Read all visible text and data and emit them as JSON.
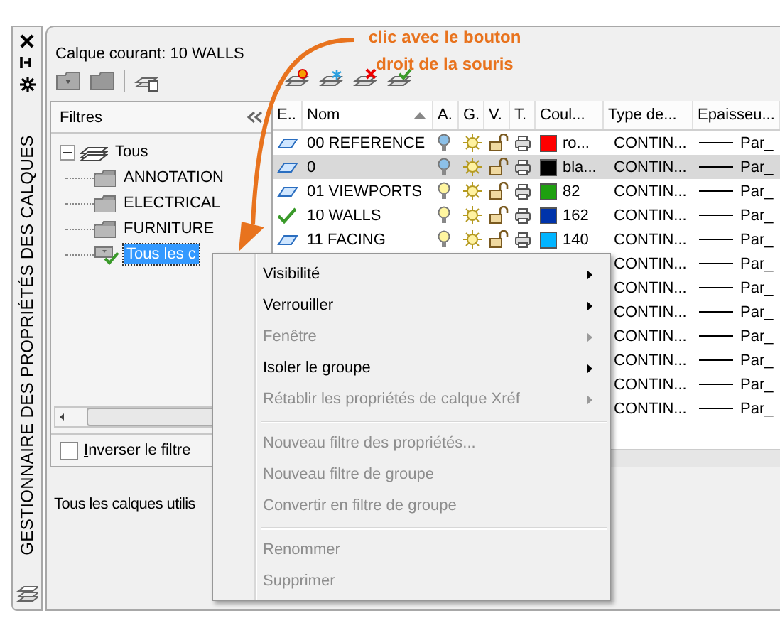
{
  "side_strip": {
    "title": "GESTIONNAIRE DES PROPRIÉTÉS DES CALQUES"
  },
  "annotation": {
    "text": "clic avec le bouton droit de la souris"
  },
  "current_layer": "Calque courant: 10 WALLS",
  "filters": {
    "title": "Filtres",
    "tree": [
      {
        "label": "Tous",
        "kind": "all",
        "expanded": true,
        "selected": false,
        "children": [
          {
            "label": "ANNOTATION",
            "kind": "group",
            "selected": false
          },
          {
            "label": "ELECTRICAL",
            "kind": "group",
            "selected": false
          },
          {
            "label": "FURNITURE",
            "kind": "group",
            "selected": false
          },
          {
            "label": "Tous les c",
            "kind": "used",
            "selected": true
          }
        ]
      }
    ],
    "invert": {
      "label": "Inverser le filtre",
      "checked": false
    }
  },
  "table": {
    "columns": [
      {
        "label": "E..",
        "sorted": false
      },
      {
        "label": "Nom",
        "sorted": true
      },
      {
        "label": "A.",
        "sorted": false
      },
      {
        "label": "G.",
        "sorted": false
      },
      {
        "label": "V.",
        "sorted": false
      },
      {
        "label": "T.",
        "sorted": false
      },
      {
        "label": "Coul...",
        "sorted": false
      },
      {
        "label": "Type de...",
        "sorted": false
      },
      {
        "label": "Epaisseu...",
        "sorted": false
      }
    ],
    "rows": [
      {
        "kind": "layer",
        "name": "00 REFERENCE",
        "on": false,
        "color": "#ff0000",
        "color_name": "ro...",
        "linetype": "CONTIN...",
        "lineweight": "Par_",
        "selected": false
      },
      {
        "kind": "layer",
        "name": "0",
        "on": false,
        "color": "#000000",
        "color_name": "bla...",
        "linetype": "CONTIN...",
        "lineweight": "Par_",
        "selected": true
      },
      {
        "kind": "layer",
        "name": "01 VIEWPORTS",
        "on": true,
        "color": "#1ea010",
        "color_name": "82",
        "linetype": "CONTIN...",
        "lineweight": "Par_",
        "selected": false
      },
      {
        "kind": "current",
        "name": "10 WALLS",
        "on": true,
        "color": "#0033aa",
        "color_name": "162",
        "linetype": "CONTIN...",
        "lineweight": "Par_",
        "selected": false
      },
      {
        "kind": "layer",
        "name": "11 FACING",
        "on": true,
        "color": "#00b4ff",
        "color_name": "140",
        "linetype": "CONTIN...",
        "lineweight": "Par_",
        "selected": false
      },
      {
        "linetype": "CONTIN...",
        "lineweight": "Par_",
        "selected": false
      },
      {
        "linetype": "CONTIN...",
        "lineweight": "Par_",
        "selected": false
      },
      {
        "linetype": "CONTIN...",
        "lineweight": "Par_",
        "selected": false
      },
      {
        "linetype": "CONTIN...",
        "lineweight": "Par_",
        "selected": false
      },
      {
        "linetype": "CONTIN...",
        "lineweight": "Par_",
        "selected": false
      },
      {
        "linetype": "CONTIN...",
        "lineweight": "Par_",
        "selected": false
      },
      {
        "linetype": "CONTIN...",
        "lineweight": "Par_",
        "selected": false
      }
    ]
  },
  "status_bar": "Tous les calques utilis",
  "context_menu": [
    {
      "kind": "item",
      "label": "Visibilité",
      "disabled": false,
      "submenu": true
    },
    {
      "kind": "item",
      "label": "Verrouiller",
      "disabled": false,
      "submenu": true
    },
    {
      "kind": "item",
      "label": "Fenêtre",
      "disabled": true,
      "submenu": true
    },
    {
      "kind": "item",
      "label": "Isoler le groupe",
      "disabled": false,
      "submenu": true
    },
    {
      "kind": "item",
      "label": "Rétablir les propriétés de calque Xréf",
      "disabled": true,
      "submenu": true
    },
    {
      "kind": "separator"
    },
    {
      "kind": "item",
      "label": "Nouveau filtre des propriétés...",
      "disabled": true,
      "submenu": false
    },
    {
      "kind": "item",
      "label": "Nouveau filtre de groupe",
      "disabled": true,
      "submenu": false
    },
    {
      "kind": "item",
      "label": "Convertir en filtre de groupe",
      "disabled": true,
      "submenu": false
    },
    {
      "kind": "separator"
    },
    {
      "kind": "item",
      "label": "Renommer",
      "disabled": true,
      "submenu": false
    },
    {
      "kind": "item",
      "label": "Supprimer",
      "disabled": true,
      "submenu": false
    }
  ]
}
